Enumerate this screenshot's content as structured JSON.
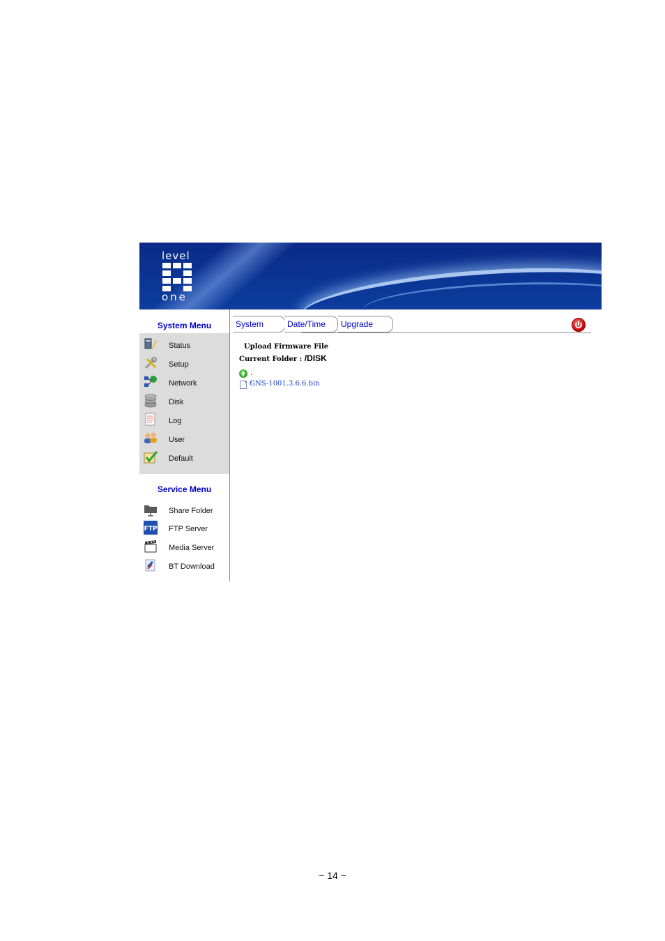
{
  "brand": {
    "logo_top": "level",
    "logo_bottom": "one"
  },
  "system_menu": {
    "title": "System Menu",
    "items": [
      {
        "label": "Status",
        "icon": "status-icon"
      },
      {
        "label": "Setup",
        "icon": "setup-icon"
      },
      {
        "label": "Network",
        "icon": "network-icon"
      },
      {
        "label": "Disk",
        "icon": "disk-icon"
      },
      {
        "label": "Log",
        "icon": "log-icon"
      },
      {
        "label": "User",
        "icon": "user-icon"
      },
      {
        "label": "Default",
        "icon": "default-icon"
      }
    ]
  },
  "service_menu": {
    "title": "Service Menu",
    "items": [
      {
        "label": "Share Folder",
        "icon": "share-folder-icon"
      },
      {
        "label": "FTP Server",
        "icon": "ftp-icon"
      },
      {
        "label": "Media Server",
        "icon": "media-server-icon"
      },
      {
        "label": "BT Download",
        "icon": "bt-download-icon"
      }
    ]
  },
  "tabs": [
    {
      "label": "System"
    },
    {
      "label": "Date/Time"
    },
    {
      "label": "Upgrade"
    }
  ],
  "content": {
    "title": "Upload Firmware File",
    "folder_label": "Current Folder :",
    "folder_path": "/DISK",
    "parent_link": ". .",
    "file_name": "GNS-1001.3.6.6.bin"
  },
  "footer": {
    "page_number": "~ 14 ~"
  },
  "colors": {
    "banner": "#0a2a86",
    "menu_title": "#0000cc",
    "menu_bg": "#dcdcdc",
    "link": "#1a3cc8",
    "power": "#c40000"
  }
}
